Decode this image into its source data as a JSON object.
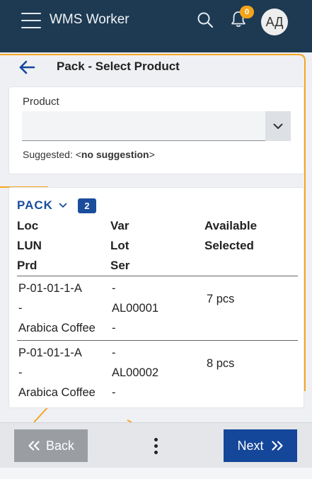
{
  "topbar": {
    "app_title": "WMS Worker",
    "menu_icon": "hamburger-icon",
    "search_icon": "search-icon",
    "notifications": {
      "icon": "bell-icon",
      "count": "0"
    },
    "avatar_initials": "АД",
    "background": "#1d3a52"
  },
  "page": {
    "title": "Pack - Select Product"
  },
  "product_form": {
    "label": "Product",
    "selected_value": "",
    "suggested_prefix": "Suggested: <",
    "suggested_value": "no suggestion",
    "suggested_suffix": ">"
  },
  "list": {
    "group_label": "PACK",
    "group_count": "2",
    "headers": {
      "col1": [
        "Loc",
        "LUN",
        "Prd"
      ],
      "col2": [
        "Var",
        "Lot",
        "Ser"
      ],
      "col3": [
        "Available",
        "Selected"
      ]
    },
    "rows": [
      {
        "loc": "P-01-01-1-A",
        "lun": "-",
        "prd": "Arabica Coffee",
        "var": "-",
        "lot": "AL00001",
        "ser": "-",
        "available": "7 pcs",
        "selected": ""
      },
      {
        "loc": "P-01-01-1-A",
        "lun": "-",
        "prd": "Arabica Coffee",
        "var": "-",
        "lot": "AL00002",
        "ser": "-",
        "available": "8 pcs",
        "selected": ""
      }
    ]
  },
  "bottombar": {
    "back_label": "Back",
    "next_label": "Next",
    "more_icon": "more-vertical-icon"
  },
  "colors": {
    "accent": "#1a4d9c",
    "next_button": "#14469a",
    "back_button": "#9a9ea3",
    "badge": "#f5a31a",
    "decoration_line": "#f5a623"
  }
}
